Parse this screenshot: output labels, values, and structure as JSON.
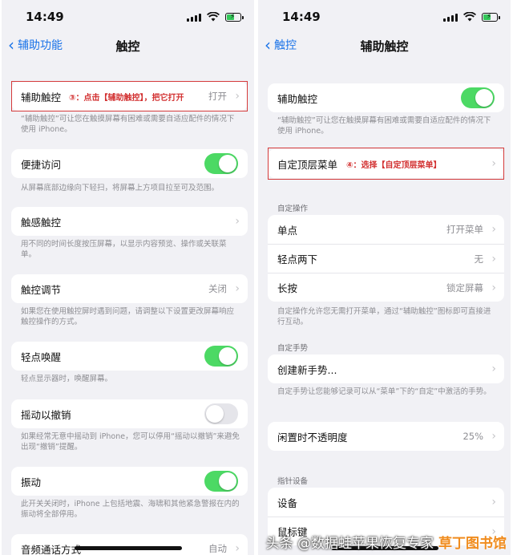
{
  "left": {
    "status_time": "14:49",
    "back_label": "辅助功能",
    "title": "触控",
    "annotation": "③：点击【辅助触控】，把它打开",
    "rows": [
      {
        "label": "辅助触控",
        "value": "打开",
        "note": "“辅助触控”可让您在触摸屏幕有困难或需要自适应配件的情况下使用 iPhone。"
      },
      {
        "label": "便捷访问",
        "toggle": "on",
        "note": "从屏幕底部边缘向下轻扫，将屏幕上方项目拉至可及范围。"
      },
      {
        "label": "触感触控",
        "note": "用不同的时间长度按压屏幕，以显示内容预览、操作或关联菜单。"
      },
      {
        "label": "触控调节",
        "value": "关闭",
        "note": "如果您在使用触控屏时遇到问题，请调整以下设置更改屏幕响应触控操作的方式。"
      },
      {
        "label": "轻点唤醒",
        "toggle": "on",
        "note": "轻点显示器时，唤醒屏幕。"
      },
      {
        "label": "摇动以撤销",
        "toggle": "off",
        "note": "如果经常无意中摇动到 iPhone，您可以停用“摇动以撤销”来避免出现“撤销”提醒。"
      },
      {
        "label": "振动",
        "toggle": "on",
        "note": "此开关关闭时，iPhone 上包括地震、海啸和其他紧急警报在内的振动将全部停用。"
      },
      {
        "label": "音频通话方式",
        "value": "自动"
      }
    ]
  },
  "right": {
    "status_time": "14:49",
    "back_label": "触控",
    "title": "辅助触控",
    "annotation": "④：选择【自定顶层菜单】",
    "assistive_label": "辅助触控",
    "assistive_note": "“辅助触控”可让您在触摸屏幕有困难或需要自适应配件的情况下使用 iPhone。",
    "top_menu_label": "自定顶层菜单",
    "custom_actions_header": "自定操作",
    "actions": [
      {
        "label": "单点",
        "value": "打开菜单"
      },
      {
        "label": "轻点两下",
        "value": "无"
      },
      {
        "label": "长按",
        "value": "锁定屏幕"
      }
    ],
    "actions_note": "自定操作允许您无需打开菜单，通过“辅助触控”图标即可直接进行互动。",
    "gestures_header": "自定手势",
    "new_gesture_label": "创建新手势...",
    "gestures_note": "自定手势让您能够记录可以从“菜单”下的“自定”中激活的手势。",
    "idle_label": "闲置时不透明度",
    "idle_value": "25%",
    "pointer_header": "指针设备",
    "devices_label": "设备",
    "mouse_keys_label": "鼠标键"
  },
  "watermark": {
    "text": "头条 @数据蛙苹果恢复专家",
    "logo": "草丁图书馆"
  },
  "colors": {
    "accent": "#1a73e8",
    "toggle_on": "#4cd964",
    "annotation": "#d23030"
  },
  "icons": [
    "cellular-signal-icon",
    "wifi-icon",
    "battery-charging-icon",
    "chevron-left-icon",
    "chevron-right-icon"
  ]
}
